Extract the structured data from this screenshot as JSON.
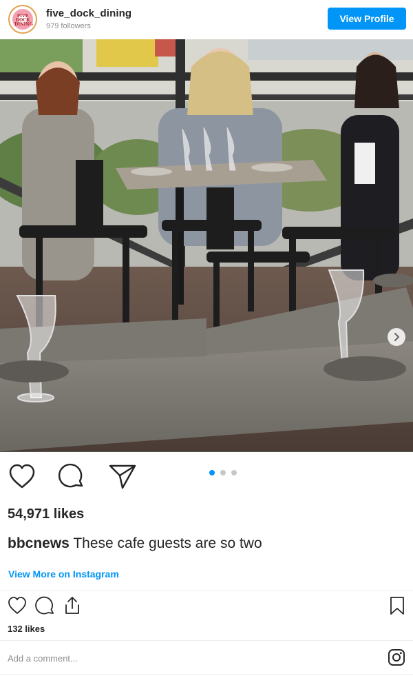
{
  "header": {
    "username": "five_dock_dining",
    "followers": "979 followers",
    "view_profile_label": "View Profile",
    "avatar_text": "FIVE DOCK DINING"
  },
  "post": {
    "image_icon": "next-arrow-icon",
    "carousel_slides": 3,
    "carousel_active": 1,
    "likes": "54,971 likes",
    "caption_user": "bbcnews",
    "caption_text": "These cafe guests are so two",
    "view_more_label": "View More on Instagram"
  },
  "embed_footer": {
    "icons": [
      "heart-icon",
      "comment-icon",
      "share-icon",
      "bookmark-icon"
    ],
    "likes": "132 likes",
    "comment_placeholder": "Add a comment...",
    "instagram_icon": "instagram-icon"
  },
  "colors": {
    "accent": "#0095f6",
    "text": "#262626",
    "muted": "#8e8e8e"
  }
}
